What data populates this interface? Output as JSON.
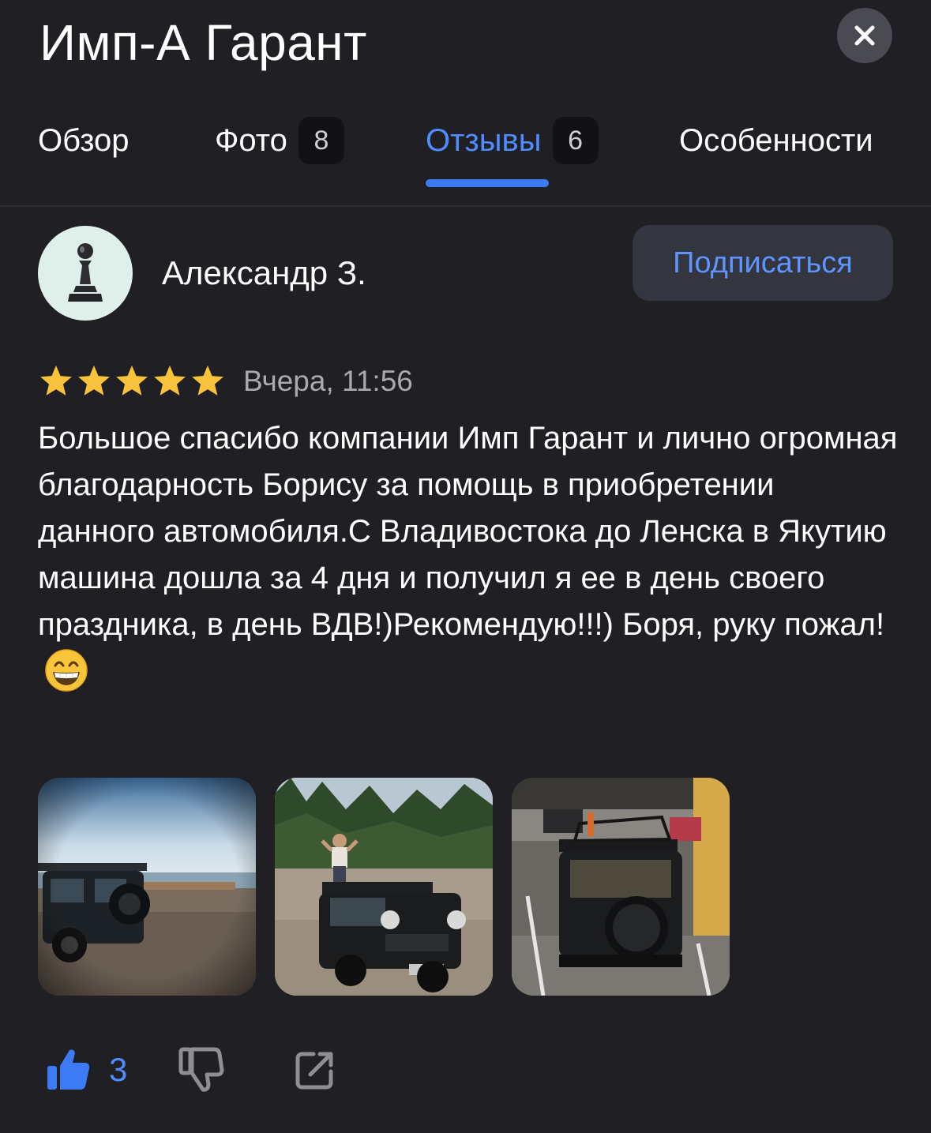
{
  "header": {
    "title": "Имп-А Гарант",
    "close_icon": "close-icon"
  },
  "tabs": [
    {
      "label": "Обзор",
      "count": null,
      "active": false
    },
    {
      "label": "Фото",
      "count": "8",
      "active": false
    },
    {
      "label": "Отзывы",
      "count": "6",
      "active": true
    },
    {
      "label": "Особенности",
      "count": null,
      "active": false
    }
  ],
  "review": {
    "author": "Александр З.",
    "avatar_icon": "chess-pawn-icon",
    "subscribe_label": "Подписаться",
    "rating": 5,
    "rating_max": 5,
    "date": "Вчера, 11:56",
    "text": "Большое спасибо компании Имп Гарант и лично огромная благодарность Борису за помощь в приобретении данного автомобиля.С Владивостока до Ленска в Якутию машина дошла за 4 дня и получил я ее в день своего праздника, в день ВДВ!)Рекомендую!!!) Боря, руку пожал!",
    "emoji": "grinning-face-icon",
    "photos": [
      "photo-car-on-riverbank",
      "photo-car-in-forest",
      "photo-car-in-parking"
    ],
    "likes": "3"
  },
  "colors": {
    "background": "#1f1f24",
    "accent": "#3d7bf5",
    "star": "#f8c33c"
  }
}
